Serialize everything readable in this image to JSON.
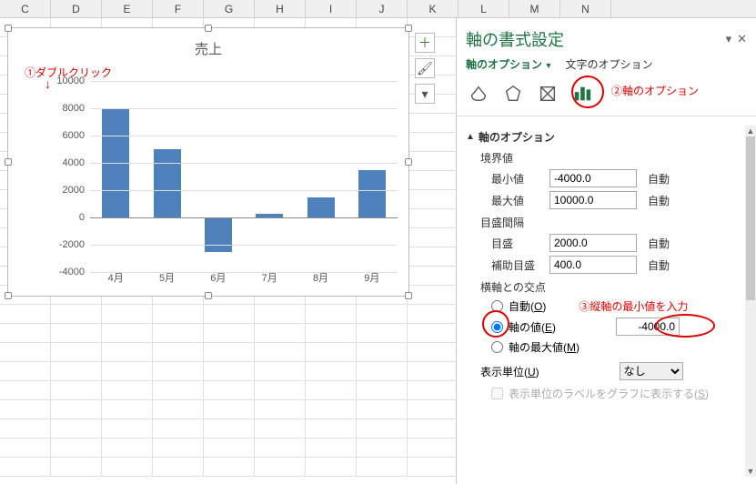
{
  "columns": [
    "C",
    "D",
    "E",
    "F",
    "G",
    "H",
    "I",
    "J",
    "K",
    "L",
    "M",
    "N"
  ],
  "chart_data": {
    "type": "bar",
    "title": "売上",
    "categories": [
      "4月",
      "5月",
      "6月",
      "7月",
      "8月",
      "9月"
    ],
    "values": [
      8000,
      5000,
      -2500,
      300,
      1500,
      3500
    ],
    "ylim": [
      -4000,
      10000
    ],
    "yticks": [
      10000,
      8000,
      6000,
      4000,
      2000,
      0,
      -2000,
      -4000
    ],
    "xlabel": "",
    "ylabel": ""
  },
  "annotations": {
    "a1": "①ダブルクリック",
    "a2": "②軸のオプション",
    "a3": "③縦軸の最小値を入力"
  },
  "pane": {
    "title": "軸の書式設定",
    "tabs": {
      "axis": "軸のオプション",
      "text": "文字のオプション"
    },
    "section_header": "軸のオプション",
    "bounds_label": "境界値",
    "min_label": "最小値",
    "min_value": "-4000.0",
    "max_label": "最大値",
    "max_value": "10000.0",
    "units_label": "目盛間隔",
    "major_label": "目盛",
    "major_value": "2000.0",
    "minor_label": "補助目盛",
    "minor_value": "400.0",
    "auto_label": "自動",
    "cross_label": "横軸との交点",
    "cross_auto": "自動(O)",
    "cross_value_label": "軸の値(E)",
    "cross_value": "-4000.0",
    "cross_max": "軸の最大値(M)",
    "display_unit_label": "表示単位(U)",
    "display_unit_value": "なし",
    "display_unit_check": "表示単位のラベルをグラフに表示する(S)"
  }
}
